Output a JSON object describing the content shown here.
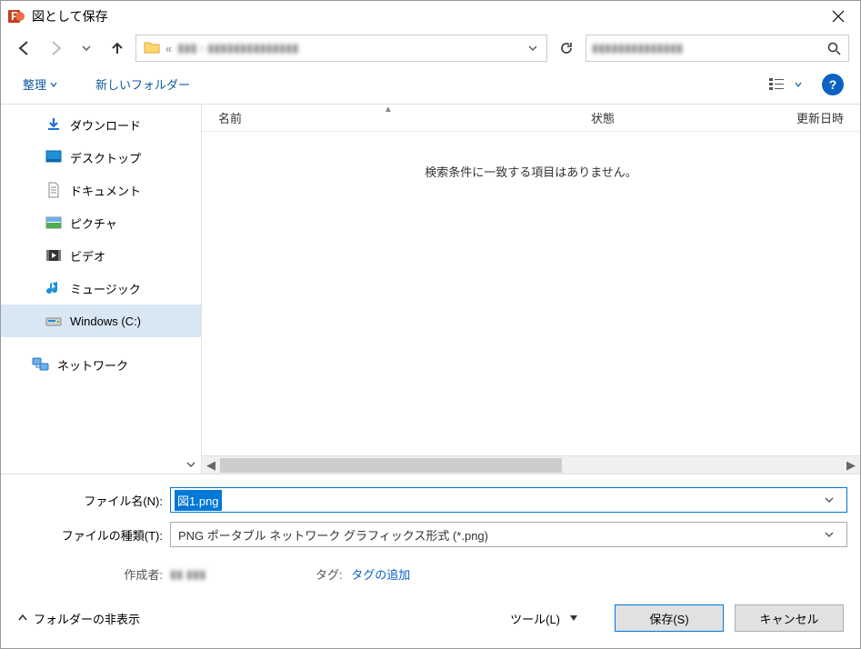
{
  "title": "図として保存",
  "nav": {
    "address_blur": "▮▮▮  ›  ▮▮▮▮▮▮▮▮▮▮▮▮▮▮",
    "search_blur": "▮▮▮▮▮▮▮▮▮▮▮▮▮▮"
  },
  "toolbar": {
    "organize": "整理",
    "new_folder": "新しいフォルダー"
  },
  "sidebar": {
    "items": [
      {
        "label": "ダウンロード",
        "icon": "download"
      },
      {
        "label": "デスクトップ",
        "icon": "desktop"
      },
      {
        "label": "ドキュメント",
        "icon": "document"
      },
      {
        "label": "ピクチャ",
        "icon": "picture"
      },
      {
        "label": "ビデオ",
        "icon": "video"
      },
      {
        "label": "ミュージック",
        "icon": "music"
      },
      {
        "label": "Windows (C:)",
        "icon": "drive",
        "selected": true
      }
    ],
    "network": "ネットワーク"
  },
  "columns": {
    "name": "名前",
    "state": "状態",
    "date": "更新日時"
  },
  "empty_message": "検索条件に一致する項目はありません。",
  "filename": {
    "label": "ファイル名(N):",
    "value": "図1.png"
  },
  "filetype": {
    "label": "ファイルの種類(T):",
    "value": "PNG ポータブル ネットワーク グラフィックス形式 (*.png)"
  },
  "meta": {
    "author_label": "作成者:",
    "author_value_blur": "▮▮ ▮▮▮",
    "tag_label": "タグ:",
    "tag_link": "タグの追加"
  },
  "footer": {
    "hide_folders": "フォルダーの非表示",
    "tools": "ツール(L)",
    "save": "保存(S)",
    "cancel": "キャンセル"
  }
}
